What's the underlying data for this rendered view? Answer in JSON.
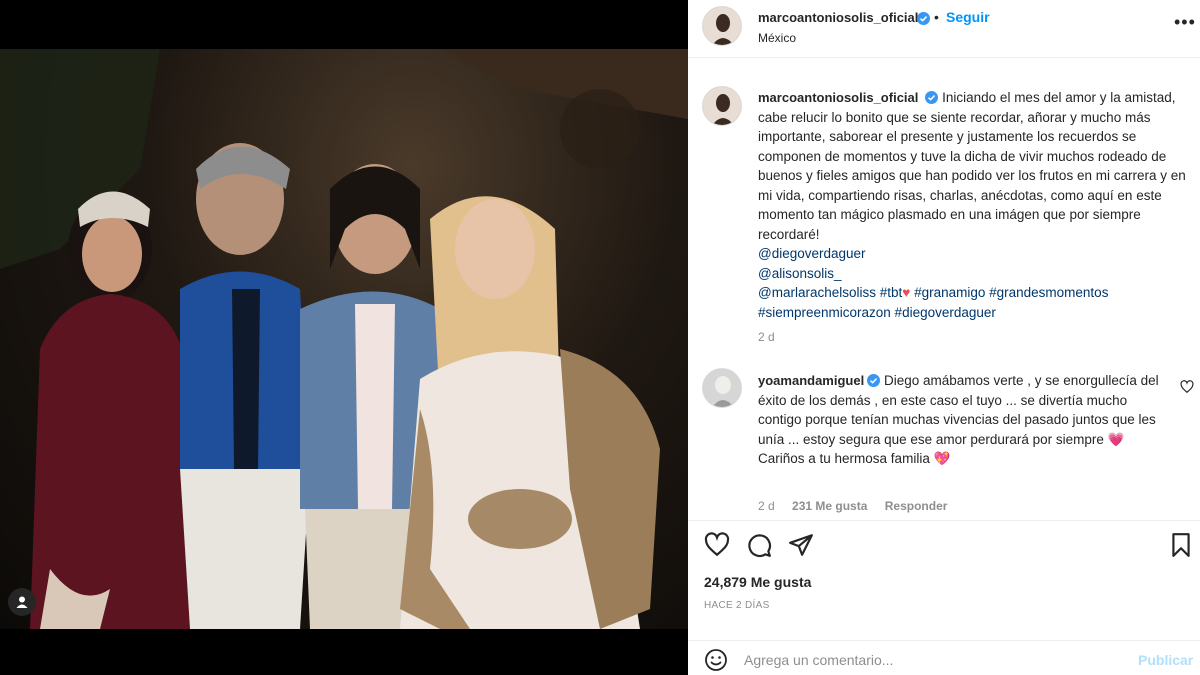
{
  "post": {
    "author": "marcoantoniosolis_oficial",
    "follow_label": "Seguir",
    "location": "México",
    "separator": "•",
    "more_label": "•••"
  },
  "caption": {
    "author": "marcoantoniosolis_oficial",
    "text": "Iniciando el mes del amor y la amistad, cabe relucir lo bonito que se siente recordar, añorar y mucho más importante, saborear el presente y justamente los recuerdos se componen de momentos y tuve la dicha de vivir muchos rodeado de buenos y fieles amigos que han podido ver los frutos en mi carrera y en mi vida, compartiendo risas, charlas, anécdotas, como aquí en este momento tan mágico plasmado en una imágen que por siempre recordaré!",
    "mentions": [
      "@diegoverdaguer",
      "@alisonsolis_"
    ],
    "line3_mention": "@marlarachelsoliss",
    "line3_tag": "#tbt",
    "line3_heart": "♥",
    "line3_tags_rest": "#granamigo #grandesmomentos",
    "line4_tags": "#siempreenmicorazon #diegoverdaguer",
    "age": "2 d"
  },
  "comment": {
    "author": "yoamandamiguel",
    "text": "Diego amábamos verte , y se enorgullecía del éxito de los demás , en este caso el tuyo ... se divertía mucho contigo porque tenían muchas vivencias del pasado juntos que les unía ... estoy segura que ese amor perdurará por siempre",
    "emoji1": "💗",
    "line2": "Cariños a tu hermosa familia",
    "emoji2": "💖",
    "age": "2 d",
    "likes": "231 Me gusta",
    "reply_label": "Responder"
  },
  "stats": {
    "likes": "24,879 Me gusta",
    "time_ago": "Hace 2 días"
  },
  "composer": {
    "placeholder": "Agrega un comentario...",
    "submit_label": "Publicar"
  },
  "colors": {
    "accent": "#0095f6",
    "link": "#00376b",
    "muted": "#8e8e8e",
    "post_disabled": "#b2dffc"
  },
  "icons": [
    "user-tag-icon",
    "verified-icon",
    "more-options-icon",
    "heart-icon",
    "comment-icon",
    "share-icon",
    "bookmark-icon",
    "emoji-icon"
  ]
}
